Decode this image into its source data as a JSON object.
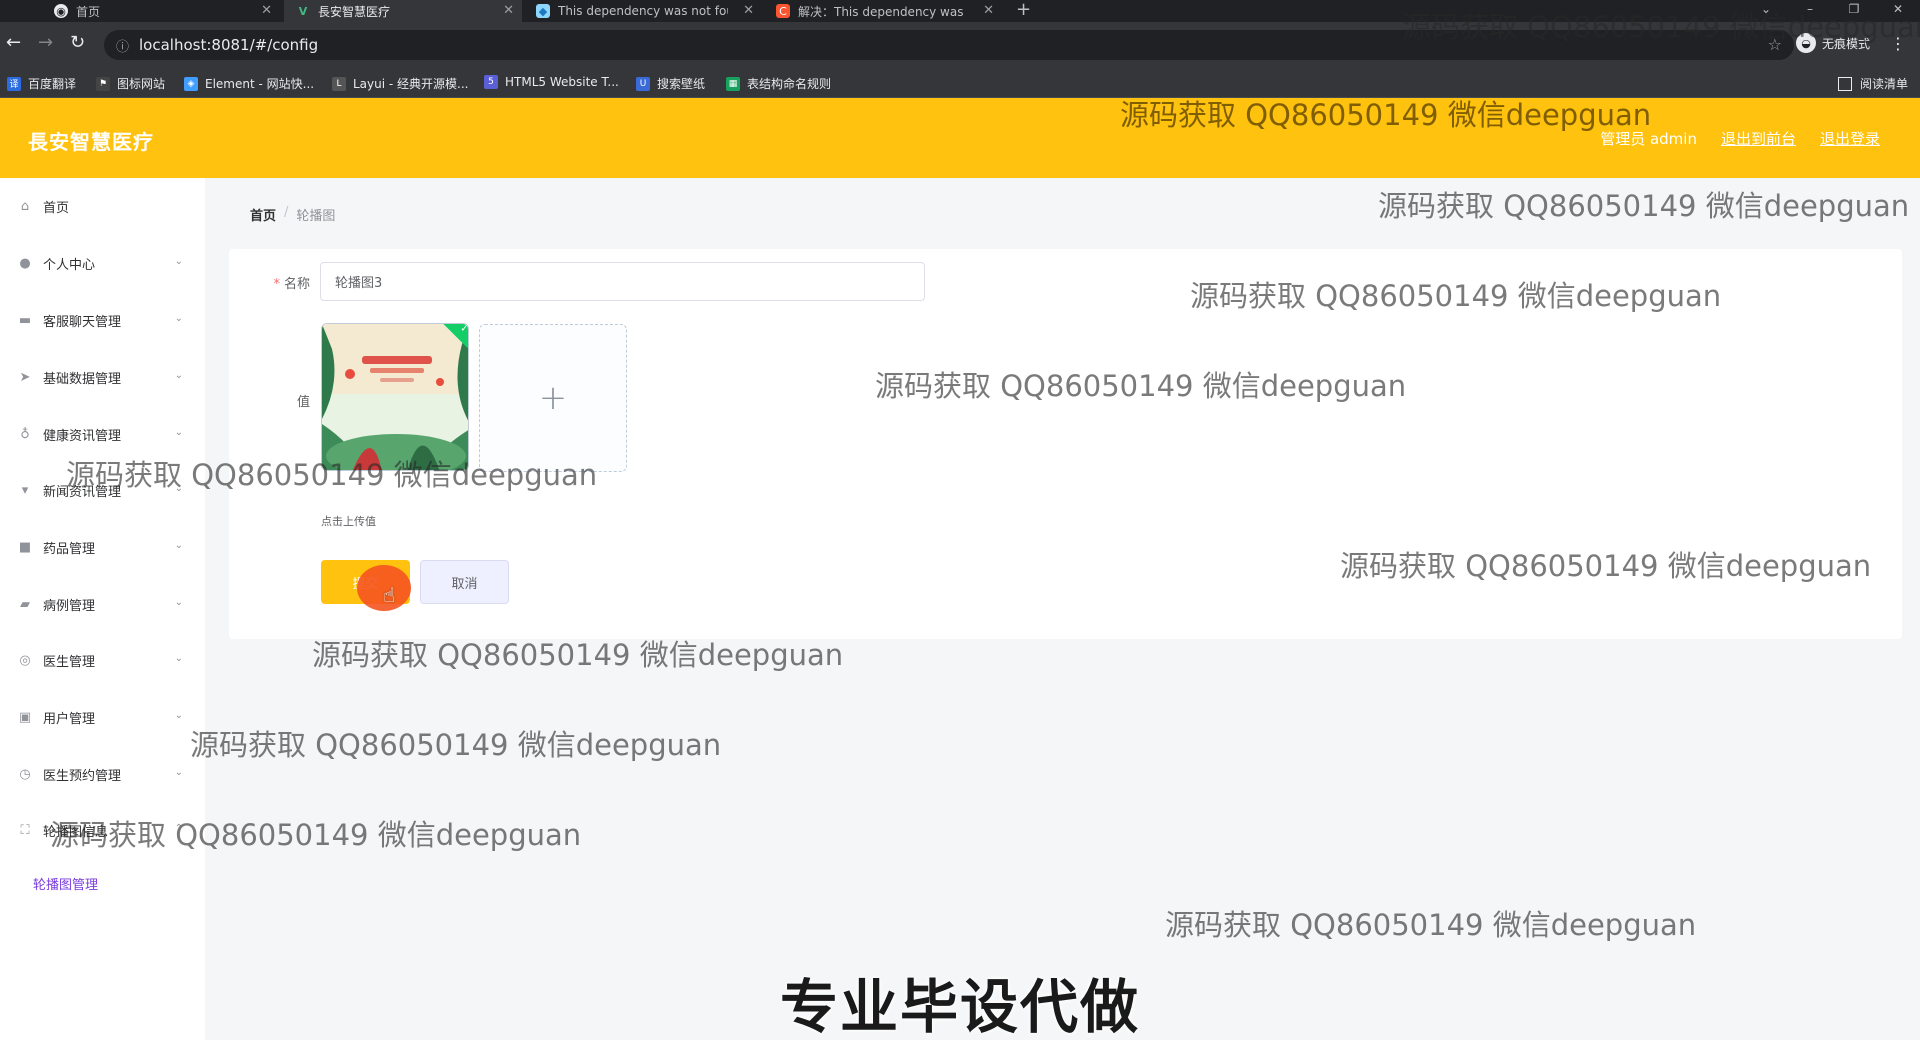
{
  "browser": {
    "tabs": [
      {
        "title": "首页",
        "icon": "site-icon",
        "active": false
      },
      {
        "title": "長安智慧医疗",
        "icon": "vue-logo-icon",
        "active": true
      },
      {
        "title": "This dependency was not found",
        "icon": "webpack-icon",
        "active": false
      },
      {
        "title": "解决：This dependency was no",
        "icon": "csdn-icon",
        "active": false
      }
    ],
    "new_tab": "+",
    "url": "localhost:8081/#/config",
    "profile_label": "无痕模式",
    "bookmarks": [
      {
        "label": "百度翻译",
        "color": "#2d6cdf"
      },
      {
        "label": "图标网站",
        "color": "#444444"
      },
      {
        "label": "Element - 网站快...",
        "color": "#409eff"
      },
      {
        "label": "Layui - 经典开源模...",
        "color": "#555555"
      },
      {
        "label": "HTML5 Website T...",
        "color": "#5b5fd6"
      },
      {
        "label": "搜索壁纸",
        "color": "#3a6ad6"
      },
      {
        "label": "表结构命名规则",
        "color": "#19a15f"
      }
    ],
    "reading_list": "阅读清单"
  },
  "header": {
    "brand": "長安智慧医疗",
    "admin_label": "管理员 admin",
    "front_link": "退出到前台",
    "logout_link": "退出登录",
    "accent_color": "#ffc20e"
  },
  "sidebar": {
    "items": [
      {
        "label": "首页",
        "icon": "home-icon",
        "arrow": false
      },
      {
        "label": "个人中心",
        "icon": "user-icon",
        "arrow": true
      },
      {
        "label": "客服聊天管理",
        "icon": "monitor-icon",
        "arrow": true
      },
      {
        "label": "基础数据管理",
        "icon": "send-icon",
        "arrow": true
      },
      {
        "label": "健康资讯管理",
        "icon": "microphone-icon",
        "arrow": true
      },
      {
        "label": "新闻资讯管理",
        "icon": "news-icon",
        "arrow": true
      },
      {
        "label": "药品管理",
        "icon": "box-icon",
        "arrow": true
      },
      {
        "label": "病例管理",
        "icon": "folder-icon",
        "arrow": true
      },
      {
        "label": "医生管理",
        "icon": "doctor-icon",
        "arrow": true
      },
      {
        "label": "用户管理",
        "icon": "clipboard-icon",
        "arrow": true
      },
      {
        "label": "医生预约管理",
        "icon": "clock-icon",
        "arrow": true
      },
      {
        "label": "轮播图信息",
        "icon": "fullscreen-icon",
        "arrow": true
      }
    ],
    "sub_item": "轮播图管理"
  },
  "breadcrumb": {
    "home": "首页",
    "separator": "/",
    "current": "轮播图"
  },
  "form": {
    "name_label": "名称",
    "required_mark": "*",
    "name_value": "轮播图3",
    "value_label": "值",
    "upload_plus": "+",
    "upload_hint": "点击上传值",
    "submit_label": "提交",
    "cancel_label": "取消"
  },
  "overlay": {
    "watermark": "源码获取 QQ86050149 微信deepguan",
    "caption": "专业毕设代做"
  }
}
